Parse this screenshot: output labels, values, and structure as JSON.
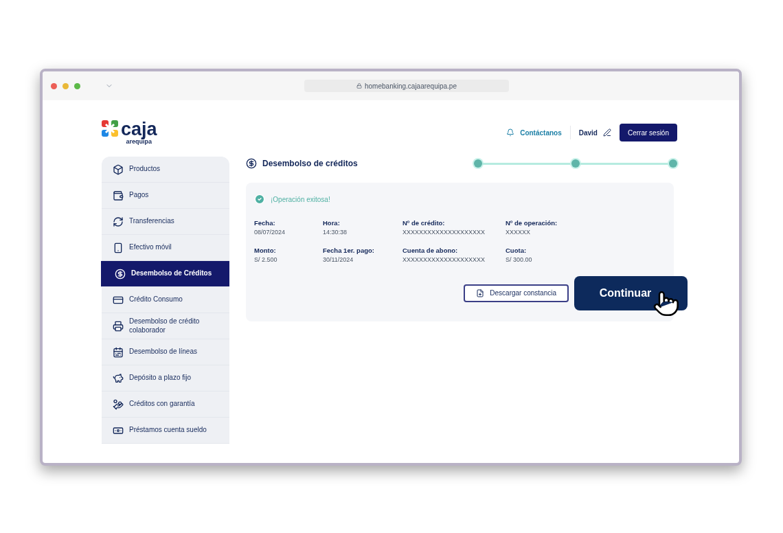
{
  "browser": {
    "url": "homebanking.cajaarequipa.pe"
  },
  "header": {
    "logo_name": "caja",
    "logo_sub": "arequipa",
    "contact": "Contáctanos",
    "user": "David",
    "logout": "Cerrar sesión"
  },
  "sidebar": {
    "items": [
      {
        "label": "Productos",
        "selected": false
      },
      {
        "label": "Pagos",
        "selected": false
      },
      {
        "label": "Transferencias",
        "selected": false
      },
      {
        "label": "Efectivo móvil",
        "selected": false
      },
      {
        "label": "Desembolso de Créditos",
        "selected": true
      },
      {
        "label": "Crédito Consumo",
        "selected": false
      },
      {
        "label": "Desembolso de crédito colaborador",
        "selected": false
      },
      {
        "label": "Desembolso de líneas",
        "selected": false
      },
      {
        "label": "Depósito a plazo fijo",
        "selected": false
      },
      {
        "label": "Créditos con garantía",
        "selected": false
      },
      {
        "label": "Préstamos cuenta sueldo",
        "selected": false
      }
    ]
  },
  "page": {
    "title": "Desembolso de créditos",
    "steps": [
      {
        "completed": true
      },
      {
        "completed": true
      },
      {
        "completed": true
      }
    ],
    "result": {
      "message": "¡Operación exitosa!",
      "fields": [
        {
          "label": "Fecha:",
          "value": "08/07/2024"
        },
        {
          "label": "Hora:",
          "value": "14:30:38"
        },
        {
          "label": "Nº de crédito:",
          "value": "XXXXXXXXXXXXXXXXXXXX"
        },
        {
          "label": "Nº de operación:",
          "value": "XXXXXX"
        },
        {
          "label": "Monto:",
          "value": "S/ 2.500"
        },
        {
          "label": "Fecha 1er. pago:",
          "value": "30/11/2024"
        },
        {
          "label": "Cuenta de abono:",
          "value": "XXXXXXXXXXXXXXXXXXXX"
        },
        {
          "label": "Cuota:",
          "value": "S/ 300.00"
        }
      ]
    },
    "buttons": {
      "download": "Descargar constancia",
      "continue": "Continuar"
    }
  }
}
